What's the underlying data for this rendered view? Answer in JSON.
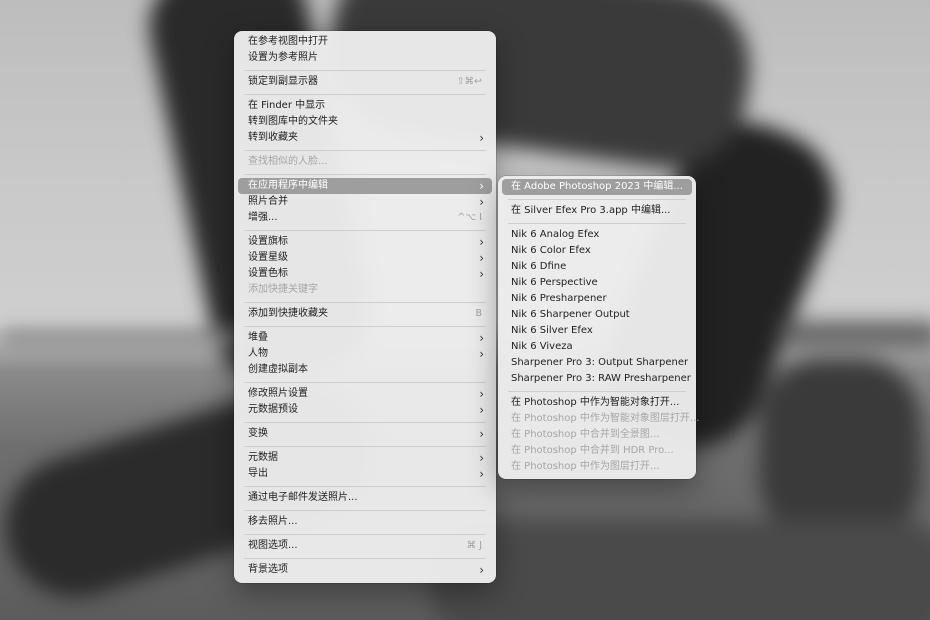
{
  "main_menu": {
    "items": [
      {
        "label": "在参考视图中打开"
      },
      {
        "label": "设置为参考照片"
      },
      {
        "label": "锁定到副显示器",
        "shortcut": "⇧⌘↩"
      },
      {
        "label": "在 Finder 中显示"
      },
      {
        "label": "转到图库中的文件夹"
      },
      {
        "label": "转到收藏夹",
        "submenu": true
      },
      {
        "label": "查找相似的人脸...",
        "disabled": true
      },
      {
        "label": "在应用程序中编辑",
        "submenu": true,
        "highlighted": true
      },
      {
        "label": "照片合并",
        "submenu": true
      },
      {
        "label": "增强...",
        "shortcut": "^⌥ I"
      },
      {
        "label": "设置旗标",
        "submenu": true
      },
      {
        "label": "设置星级",
        "submenu": true
      },
      {
        "label": "设置色标",
        "submenu": true
      },
      {
        "label": "添加快捷关键字",
        "disabled": true
      },
      {
        "label": "添加到快捷收藏夹",
        "shortcut": "B"
      },
      {
        "label": "堆叠",
        "submenu": true
      },
      {
        "label": "人物",
        "submenu": true
      },
      {
        "label": "创建虚拟副本"
      },
      {
        "label": "修改照片设置",
        "submenu": true
      },
      {
        "label": "元数据预设",
        "submenu": true
      },
      {
        "label": "变换",
        "submenu": true
      },
      {
        "label": "元数据",
        "submenu": true
      },
      {
        "label": "导出",
        "submenu": true
      },
      {
        "label": "通过电子邮件发送照片..."
      },
      {
        "label": "移去照片..."
      },
      {
        "label": "视图选项...",
        "shortcut": "⌘ J"
      },
      {
        "label": "背景选项",
        "submenu": true
      }
    ]
  },
  "sub_menu": {
    "items": [
      {
        "label": "在 Adobe Photoshop 2023 中编辑...",
        "highlighted": true
      },
      {
        "label": "在 Silver Efex Pro 3.app 中编辑..."
      },
      {
        "label": "Nik 6 Analog Efex"
      },
      {
        "label": "Nik 6 Color Efex"
      },
      {
        "label": "Nik 6 Dfine"
      },
      {
        "label": "Nik 6 Perspective"
      },
      {
        "label": "Nik 6 Presharpener"
      },
      {
        "label": "Nik 6 Sharpener Output"
      },
      {
        "label": "Nik 6 Silver Efex"
      },
      {
        "label": "Nik 6 Viveza"
      },
      {
        "label": "Sharpener Pro 3: Output Sharpener"
      },
      {
        "label": "Sharpener Pro 3: RAW Presharpener"
      },
      {
        "label": "在 Photoshop 中作为智能对象打开..."
      },
      {
        "label": "在 Photoshop 中作为智能对象图层打开...",
        "disabled": true
      },
      {
        "label": "在 Photoshop 中合并到全景图...",
        "disabled": true
      },
      {
        "label": "在 Photoshop 中合并到 HDR Pro...",
        "disabled": true
      },
      {
        "label": "在 Photoshop 中作为图层打开...",
        "disabled": true
      }
    ]
  },
  "icons": {
    "submenu_chevron": "chevron-right-icon",
    "submenu_chevron_glyph": "›"
  },
  "colors": {
    "menu_background": "#ececec",
    "highlight": "#9e9e9e",
    "text": "#1f1f1f",
    "disabled_text": "#a6a6a6"
  }
}
